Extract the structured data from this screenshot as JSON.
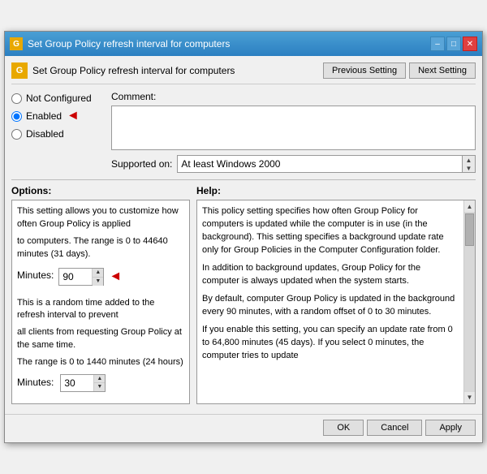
{
  "window": {
    "title": "Set Group Policy refresh interval for computers",
    "title_icon": "G",
    "controls": {
      "minimize": "–",
      "maximize": "□",
      "close": "✕"
    }
  },
  "header": {
    "icon": "G",
    "title": "Set Group Policy refresh interval for computers",
    "prev_button": "Previous Setting",
    "next_button": "Next Setting"
  },
  "settings": {
    "comment_label": "Comment:",
    "not_configured": "Not Configured",
    "enabled": "Enabled",
    "disabled": "Disabled",
    "supported_label": "Supported on:",
    "supported_value": "At least Windows 2000"
  },
  "options": {
    "header": "Options:",
    "text1": "This setting allows you to customize how often Group Policy is applied",
    "text2": "to computers. The range is 0 to 44640 minutes (31 days).",
    "minutes1_label": "Minutes:",
    "minutes1_value": "90",
    "text3": "This is a random time added to the refresh interval to prevent",
    "text4": "all clients from requesting Group Policy at the same time.",
    "text5": "The range is 0 to 1440 minutes (24 hours)",
    "minutes2_label": "Minutes:",
    "minutes2_value": "30"
  },
  "help": {
    "header": "Help:",
    "text1": "This policy setting specifies how often Group Policy for computers is updated while the computer is in use (in the background). This setting specifies a background update rate only for Group Policies in the Computer Configuration folder.",
    "text2": "In addition to background updates, Group Policy for the computer is always updated when the system starts.",
    "text3": "By default, computer Group Policy is updated in the background every 90 minutes, with a random offset of 0 to 30 minutes.",
    "text4": "If you enable this setting, you can specify an update rate from 0 to 64,800 minutes (45 days). If you select 0 minutes, the computer tries to update"
  },
  "footer": {
    "ok": "OK",
    "cancel": "Cancel",
    "apply": "Apply"
  }
}
